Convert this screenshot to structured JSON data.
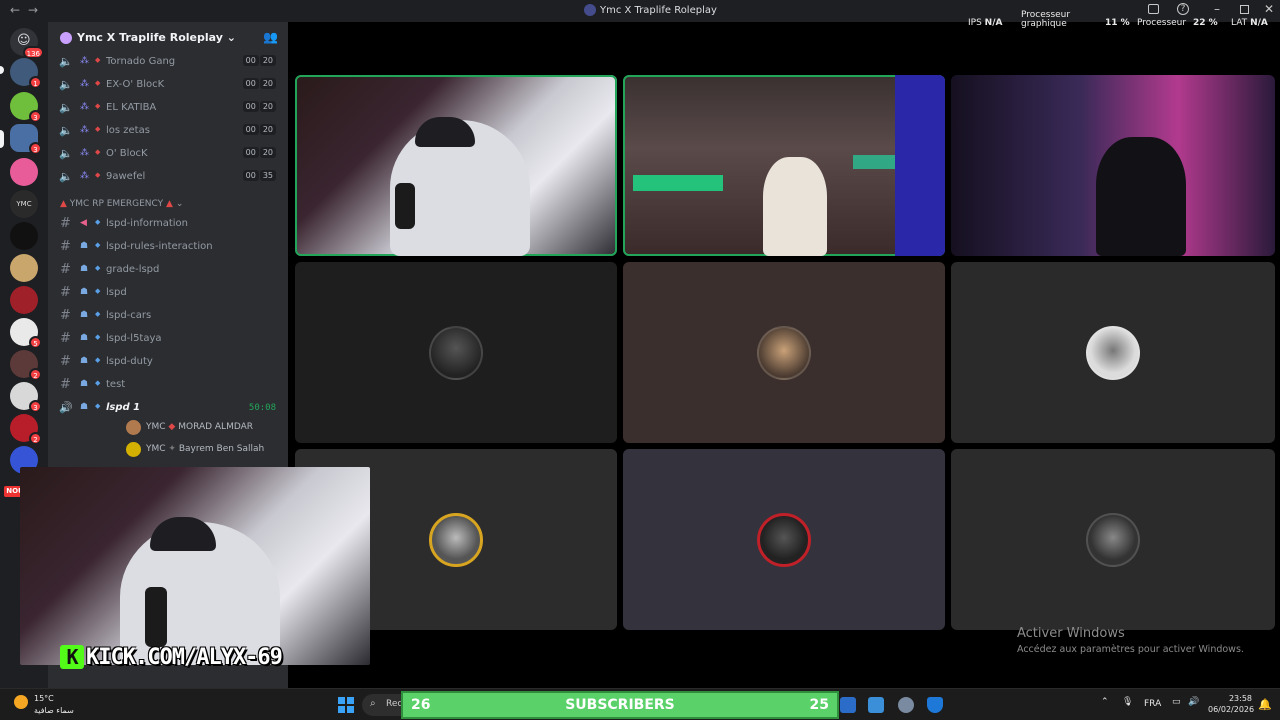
{
  "window": {
    "title": "Ymc X Traplife Roleplay",
    "back_icon": "arrow-left",
    "forward_icon": "arrow-right"
  },
  "rail": {
    "mentions_badge": "136",
    "badges": [
      "1",
      "3",
      "3",
      "5",
      "2",
      "3",
      "2"
    ],
    "live_label": "NOU"
  },
  "server": {
    "name": "Ymc X Traplife Roleplay",
    "chevron": "⌄",
    "invite_icon": "add-member"
  },
  "voice_channels": [
    {
      "label": "Tornado Gang",
      "a": "00",
      "b": "20"
    },
    {
      "label": "EX-O' BlocK",
      "a": "00",
      "b": "20"
    },
    {
      "label": "EL KATIBA",
      "a": "00",
      "b": "20"
    },
    {
      "label": "los zetas",
      "a": "00",
      "b": "20"
    },
    {
      "label": "O' BlocK",
      "a": "00",
      "b": "20"
    },
    {
      "label": "9awefel",
      "a": "00",
      "b": "35"
    }
  ],
  "category": {
    "label": "YMC RP EMERGENCY",
    "chevron": "⌄"
  },
  "text_channels": [
    {
      "label": "lspd-information"
    },
    {
      "label": "lspd-rules-interaction"
    },
    {
      "label": "grade-lspd"
    },
    {
      "label": "lspd"
    },
    {
      "label": "lspd-cars"
    },
    {
      "label": "lspd-l5taya"
    },
    {
      "label": "lspd-duty"
    },
    {
      "label": "test"
    }
  ],
  "active_voice": {
    "label": "lspd 1",
    "timer": "50:08"
  },
  "voice_users": [
    {
      "prefix": "YMC",
      "name": "MORAD ALMDAR"
    },
    {
      "prefix": "YMC",
      "name": "Bayrem Ben Sallah"
    }
  ],
  "hud": {
    "ips_label": "IPS",
    "ips_value": "N/A",
    "gpu_label_1": "Processeur",
    "gpu_label_2": "graphique",
    "gpu_value": "11 %",
    "cpu_label": "Processeur",
    "cpu_value": "22 %",
    "lat_label": "LAT",
    "lat_value": "N/A"
  },
  "kick": {
    "letter": "K",
    "url": "KICK.COM/ALYX-69"
  },
  "watermark": {
    "title": "Activer Windows",
    "subtitle": "Accédez aux paramètres pour activer Windows."
  },
  "taskbar": {
    "temp": "15°C",
    "weather": "سماء صافية",
    "search": "Rec",
    "sub_left": "26",
    "sub_center": "SUBSCRIBERS",
    "sub_right": "25",
    "lang": "FRA",
    "time": "23:58",
    "date": "06/02/2026"
  },
  "colors": {
    "discord_bg": "#2b2d31",
    "rail_bg": "#1e1f22",
    "speaking": "#23a559",
    "kick_green": "#53fc18",
    "sub_green": "#5bd16a"
  }
}
